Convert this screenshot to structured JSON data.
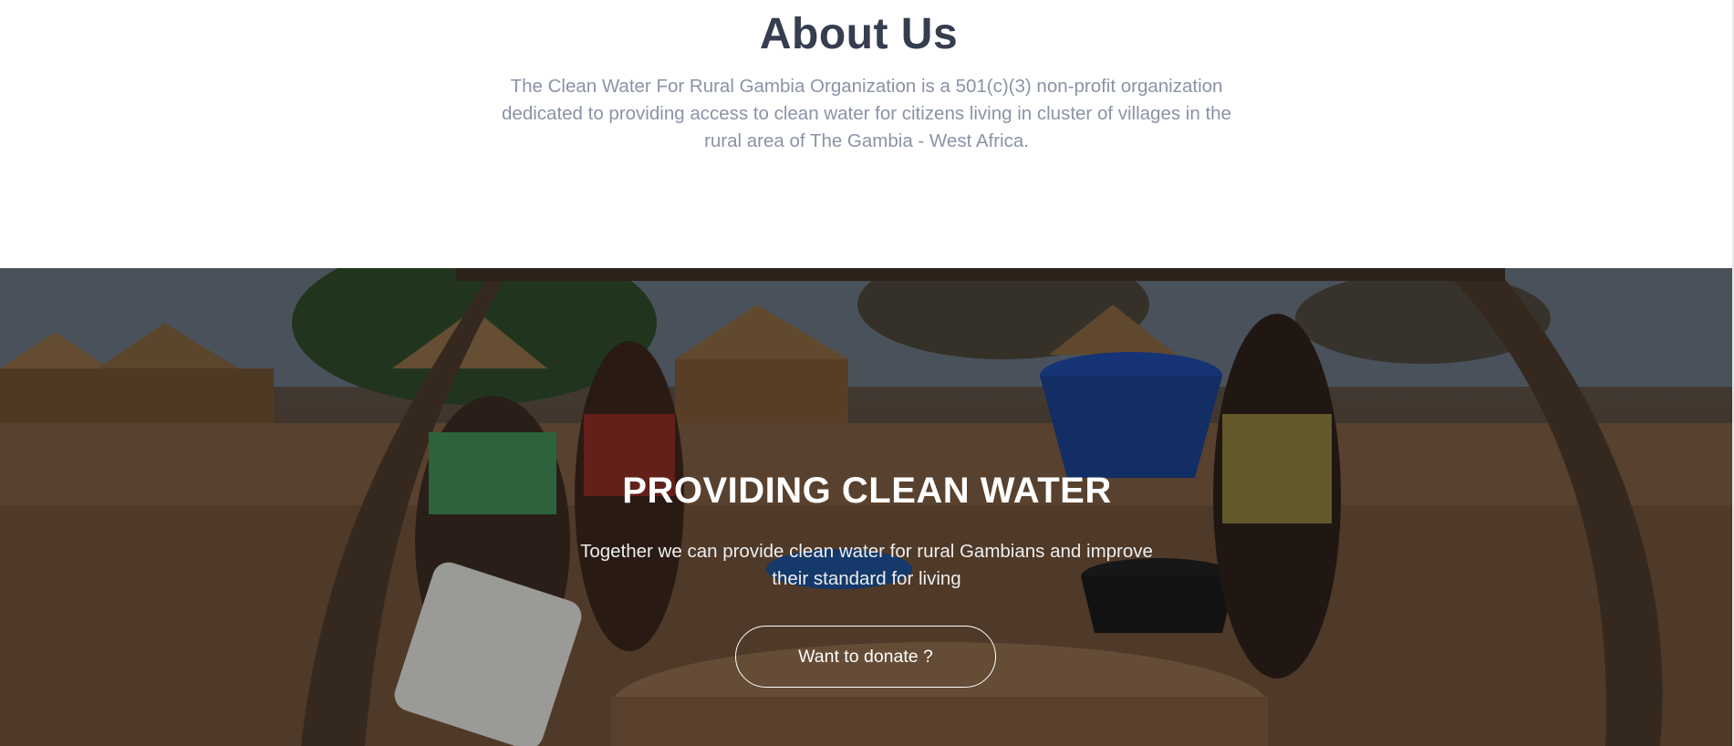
{
  "about": {
    "title": "About Us",
    "description": "The Clean Water For Rural Gambia Organization is a 501(c)(3) non-profit organization dedicated to providing access to clean water for citizens living in cluster of villages in the rural area of The Gambia - West Africa."
  },
  "hero": {
    "title": "PROVIDING CLEAN WATER",
    "subtitle": "Together we can provide clean water for rural Gambians and improve their standard for living",
    "donate_label": "Want to donate ?",
    "background_image": "women-drawing-water-from-village-well-photo"
  },
  "colors": {
    "heading": "#353d4f",
    "body_text": "#8a93a6",
    "hero_text": "#ffffff"
  }
}
